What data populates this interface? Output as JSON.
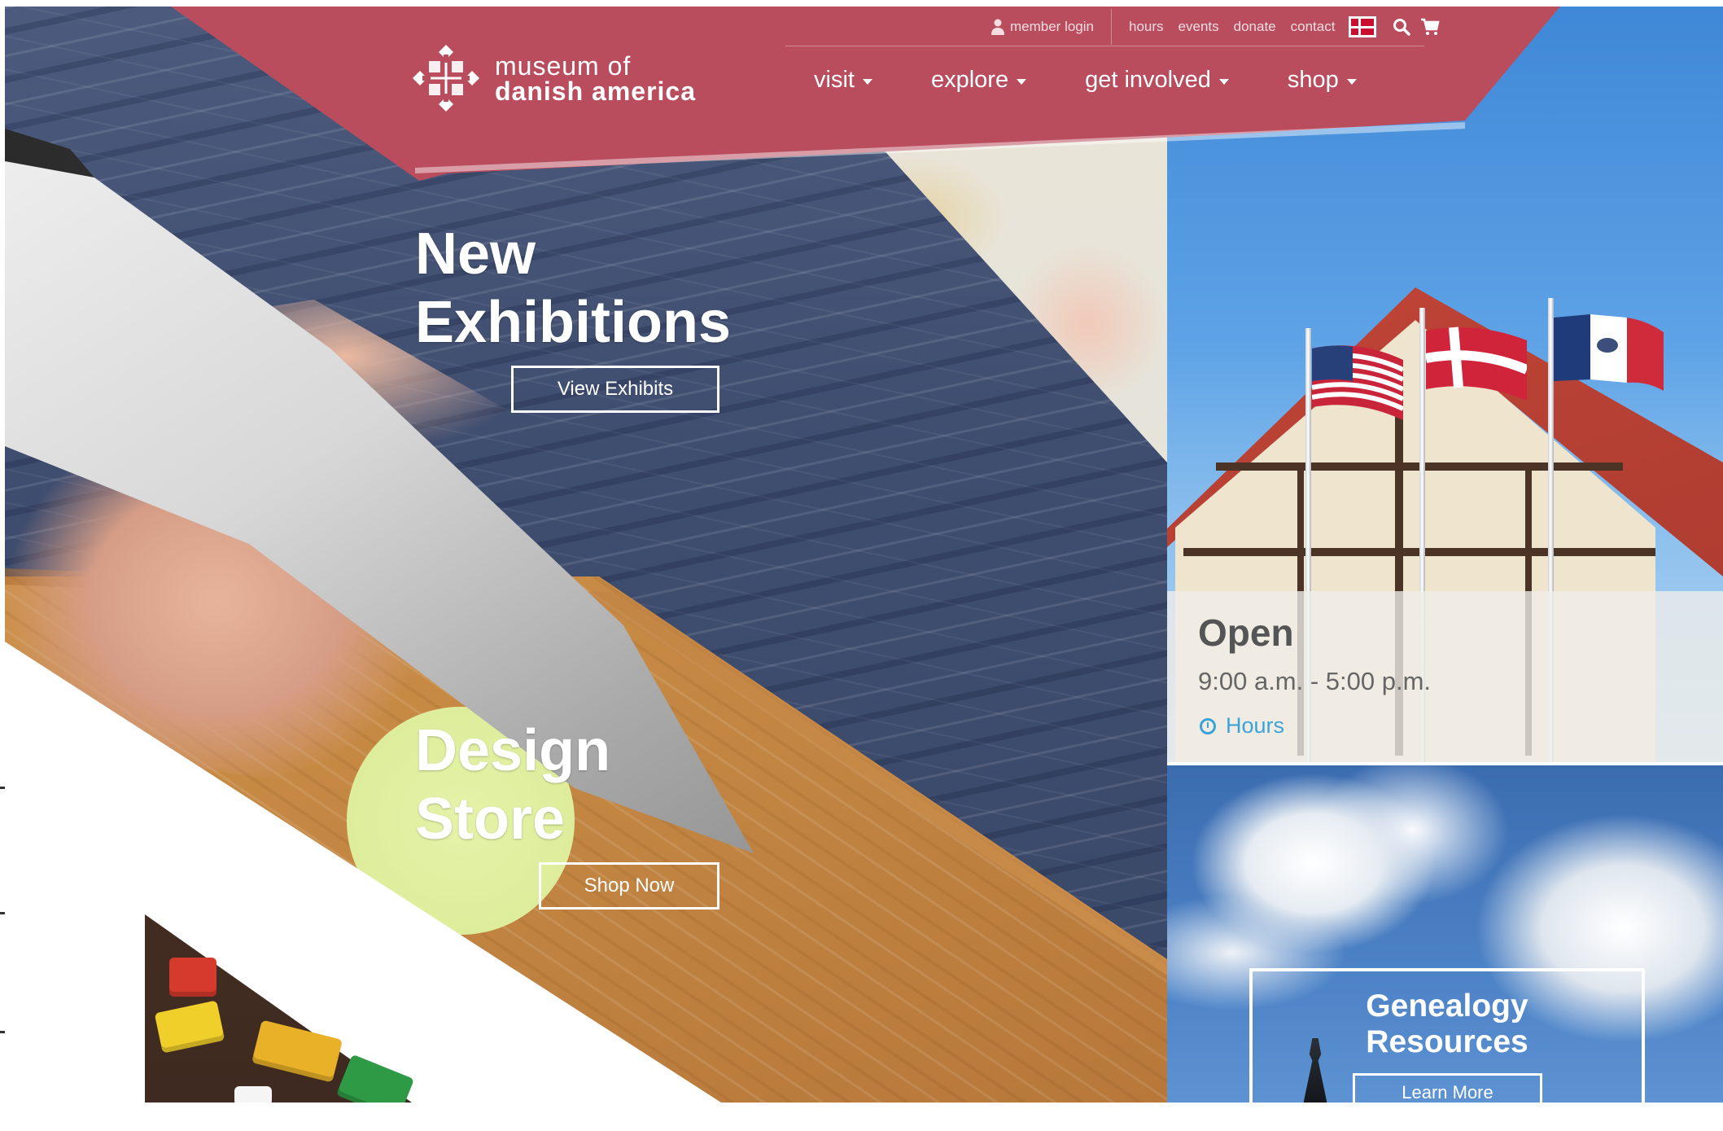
{
  "header": {
    "logo_line1": "museum of",
    "logo_line2": "danish america",
    "utility_links": {
      "member_login": "member login",
      "hours": "hours",
      "events": "events",
      "donate": "donate",
      "contact": "contact"
    },
    "utility_icons": [
      "user-icon",
      "danish-flag-icon",
      "search-icon",
      "cart-icon"
    ],
    "nav": {
      "visit": "visit",
      "explore": "explore",
      "get_involved": "get involved",
      "shop": "shop"
    }
  },
  "hero": {
    "exhibitions_title_line1": "New",
    "exhibitions_title_line2": "Exhibitions",
    "exhibitions_button": "View Exhibits",
    "store_title_line1": "Design",
    "store_title_line2": "Store",
    "store_button": "Shop Now"
  },
  "sidebar": {
    "status_title": "Open",
    "status_hours": "9:00 a.m. - 5:00 p.m.",
    "hours_link": "Hours",
    "genealogy_title_line1": "Genealogy",
    "genealogy_title_line2": "Resources",
    "genealogy_button": "Learn More"
  },
  "colors": {
    "brand": "#b94d5e",
    "link": "#3aa3d8",
    "white": "#ffffff"
  }
}
